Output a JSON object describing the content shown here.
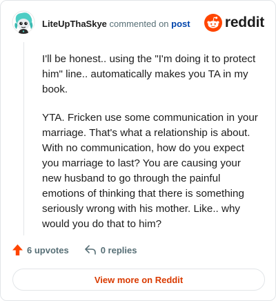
{
  "header": {
    "username": "LiteUpThaSkye",
    "commented": "commented on",
    "post_link": "post",
    "brand": "reddit"
  },
  "comment": {
    "paragraphs": [
      "I'll be honest.. using the \"I'm doing it to protect him\" line.. automatically makes you TA in my book.",
      "YTA. Fricken use some communication in your marriage. That's what a relationship is about. With no communication, how do you expect you marriage to last? You are causing your new husband to go through the painful emotions of thinking that there is something seriously wrong with his mother. Like.. why would you do that to him?"
    ]
  },
  "actions": {
    "upvotes": "6 upvotes",
    "replies": "0 replies"
  },
  "footer": {
    "view_more": "View more on Reddit"
  },
  "colors": {
    "brand": "#ff4500",
    "upvote": "#ff4500",
    "link": "#0045ac",
    "view_more": "#d93a00"
  },
  "icons": {
    "avatar": "snoo-avatar-icon",
    "brand": "reddit-logo-icon",
    "upvote": "upvote-arrow-icon",
    "reply": "reply-arrow-icon"
  }
}
